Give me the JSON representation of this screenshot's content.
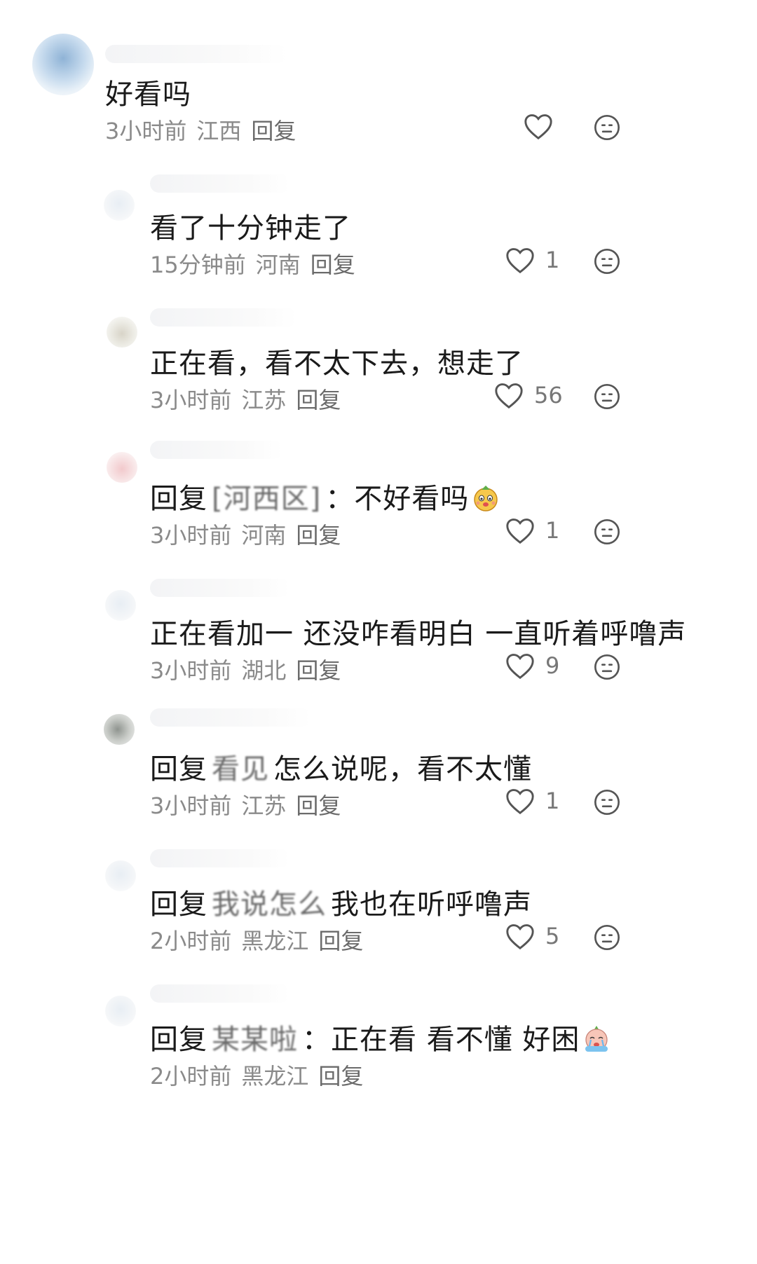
{
  "comments": [
    {
      "text": "好看吗",
      "time": "3小时前",
      "location": "江西",
      "reply_label": "回复",
      "likes": ""
    },
    {
      "text": "看了十分钟走了",
      "time": "15分钟前",
      "location": "河南",
      "reply_label": "回复",
      "likes": "1"
    },
    {
      "text": "正在看，看不太下去，想走了",
      "time": "3小时前",
      "location": "江苏",
      "reply_label": "回复",
      "likes": "56"
    },
    {
      "prefix": "回复",
      "mention": "[河西区]",
      "text": "：不好看吗",
      "time": "3小时前",
      "location": "河南",
      "reply_label": "回复",
      "likes": "1"
    },
    {
      "text": "正在看加一 还没咋看明白 一直听着呼噜声",
      "time": "3小时前",
      "location": "湖北",
      "reply_label": "回复",
      "likes": "9"
    },
    {
      "prefix": "回复",
      "mention": "看见",
      "text": "怎么说呢，看不太懂",
      "time": "3小时前",
      "location": "江苏",
      "reply_label": "回复",
      "likes": "1"
    },
    {
      "prefix": "回复",
      "mention": "我说怎么",
      "text": "我也在听呼噜声",
      "time": "2小时前",
      "location": "黑龙江",
      "reply_label": "回复",
      "likes": "5"
    },
    {
      "prefix": "回复",
      "mention": "某某啦",
      "text": "：正在看 看不懂 好困",
      "time": "2小时前",
      "location": "黑龙江",
      "reply_label": "回复",
      "likes": ""
    }
  ],
  "icons": {
    "like": "heart-outline-icon",
    "dislike": "neutral-face-icon"
  },
  "colors": {
    "text": "#1a1a1a",
    "meta": "#8a8a8a",
    "icon": "#555555"
  }
}
